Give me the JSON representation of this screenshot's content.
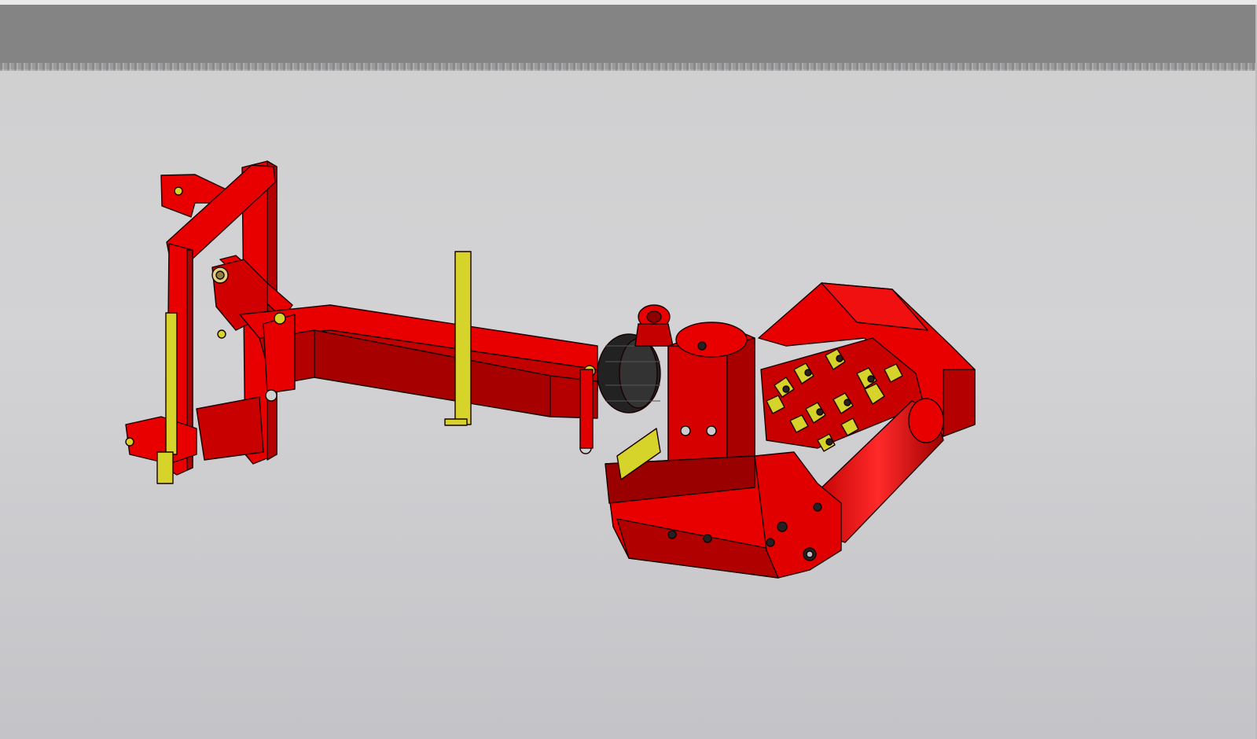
{
  "viewport": {
    "background_top": "#d3d3d5",
    "background_bottom": "#c4c4c8",
    "band_color": "#848485"
  },
  "model": {
    "icon": "flail-mower-3d-model",
    "colors": {
      "body": "#e80000",
      "body_shade": "#b50000",
      "body_dark": "#8e0000",
      "accent": "#d6d42a",
      "rubber": "#222222",
      "outline": "#1a0000"
    }
  }
}
